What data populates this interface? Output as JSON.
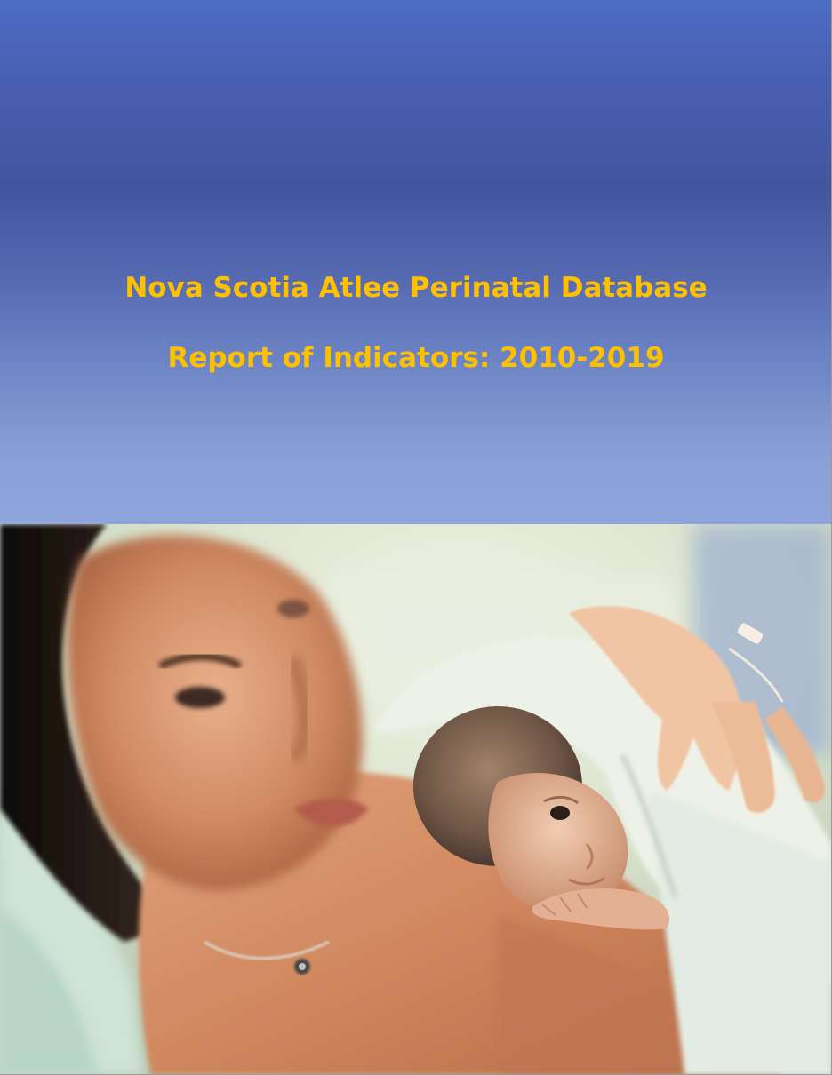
{
  "cover": {
    "title_line_1": "Nova Scotia Atlee Perinatal Database",
    "title_line_2": "Report of Indicators: 2010-2019",
    "title_color": "#ffc000",
    "banner_color_top": "#4c6cc4",
    "banner_color_bottom": "#8ea4da"
  },
  "photo": {
    "subject": "mother-holding-newborn-skin-to-skin"
  }
}
